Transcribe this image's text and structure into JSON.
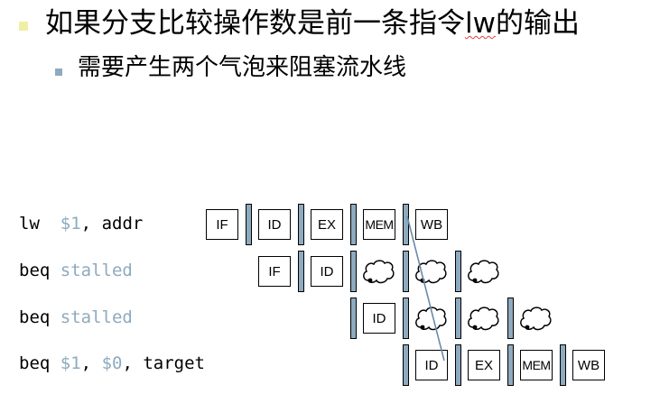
{
  "heading": {
    "line1_before": "如果分支比较操作数是前一条指令",
    "line1_lw": "lw",
    "line1_after": "的输出",
    "line2": "需要产生两个气泡来阻塞流水线"
  },
  "instructions": [
    {
      "op": "lw",
      "sep1": "  ",
      "arg1": "$1",
      "sep2": ", ",
      "arg2": "addr",
      "sep3": "",
      "arg3": "",
      "tail": ""
    },
    {
      "op": "beq",
      "sep1": " ",
      "arg1": "stalled",
      "sep2": "",
      "arg2": "",
      "sep3": "",
      "arg3": "",
      "tail": ""
    },
    {
      "op": "beq",
      "sep1": " ",
      "arg1": "stalled",
      "sep2": "",
      "arg2": "",
      "sep3": "",
      "arg3": "",
      "tail": ""
    },
    {
      "op": "beq",
      "sep1": " ",
      "arg1": "$1",
      "sep2": ", ",
      "arg2": "$0",
      "sep3": ", ",
      "arg3": "target",
      "tail": ""
    }
  ],
  "stages": {
    "row1": [
      "IF",
      "ID",
      "EX",
      "MEM",
      "WB"
    ],
    "row2": [
      "IF",
      "ID"
    ],
    "row3": [
      "ID"
    ],
    "row4": [
      "ID",
      "EX",
      "MEM",
      "WB"
    ]
  },
  "colors": {
    "register_fill": "#8eaabe",
    "highlight_text": "#8eaabe",
    "bullet1": "#efefa3",
    "bullet2": "#8eaabe",
    "forward_line": "#6a8aa8"
  }
}
